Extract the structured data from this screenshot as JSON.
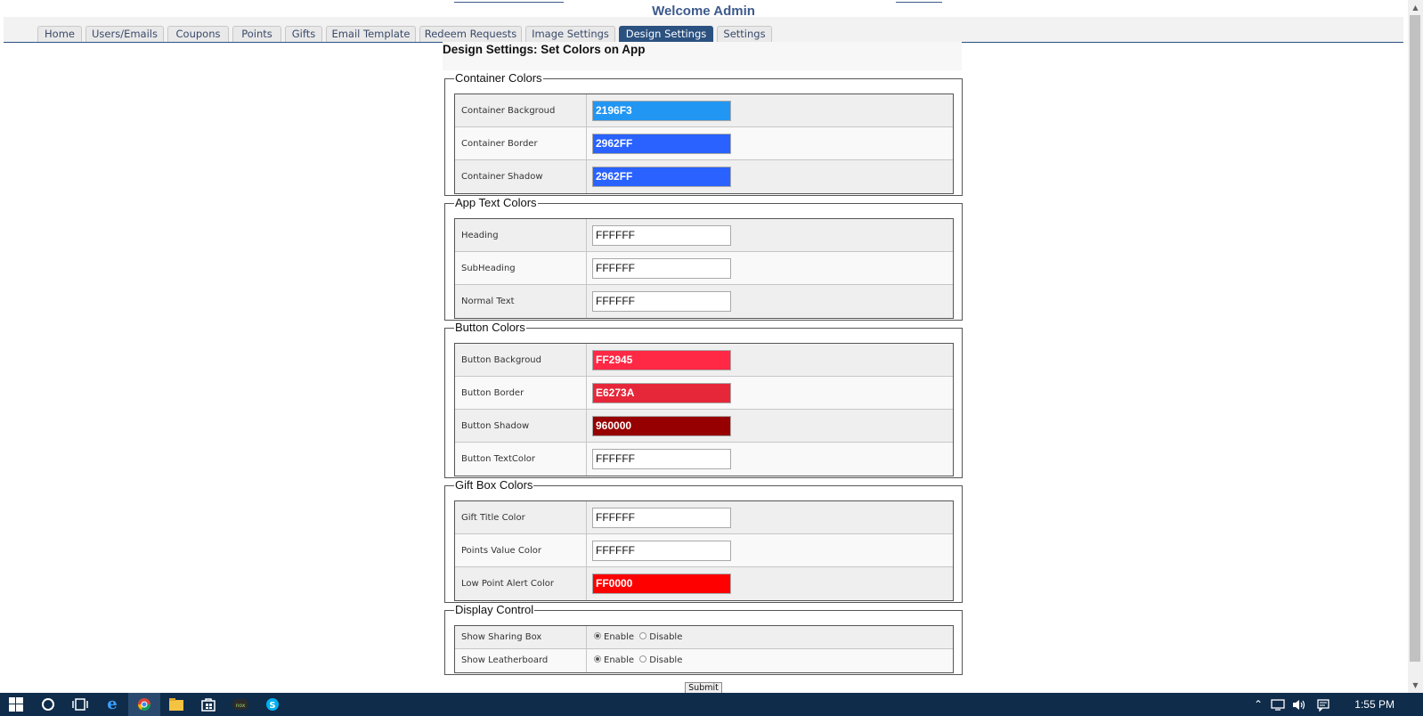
{
  "header": {
    "welcome": "Welcome Admin"
  },
  "nav": {
    "tabs": [
      {
        "label": "Home"
      },
      {
        "label": "Users/Emails"
      },
      {
        "label": "Coupons"
      },
      {
        "label": "Points"
      },
      {
        "label": "Gifts"
      },
      {
        "label": "Email Template"
      },
      {
        "label": "Redeem Requests"
      },
      {
        "label": "Image Settings"
      },
      {
        "label": "Design Settings",
        "active": true
      },
      {
        "label": "Settings"
      }
    ]
  },
  "page": {
    "title": "Design Settings: Set Colors on App"
  },
  "sections": {
    "container": {
      "legend": "Container Colors",
      "rows": [
        {
          "label": "Container Backgroud",
          "value": "2196F3",
          "color": "#2196F3"
        },
        {
          "label": "Container Border",
          "value": "2962FF",
          "color": "#2962FF"
        },
        {
          "label": "Container Shadow",
          "value": "2962FF",
          "color": "#2962FF"
        }
      ]
    },
    "app_text": {
      "legend": "App Text Colors",
      "rows": [
        {
          "label": "Heading",
          "value": "FFFFFF",
          "color": "#FFFFFF"
        },
        {
          "label": "SubHeading",
          "value": "FFFFFF",
          "color": "#FFFFFF"
        },
        {
          "label": "Normal Text",
          "value": "FFFFFF",
          "color": "#FFFFFF"
        }
      ]
    },
    "button": {
      "legend": "Button Colors",
      "rows": [
        {
          "label": "Button Backgroud",
          "value": "FF2945",
          "color": "#FF2945"
        },
        {
          "label": "Button Border",
          "value": "E6273A",
          "color": "#E6273A"
        },
        {
          "label": "Button Shadow",
          "value": "960000",
          "color": "#960000"
        },
        {
          "label": "Button TextColor",
          "value": "FFFFFF",
          "color": "#FFFFFF"
        }
      ]
    },
    "gift_box": {
      "legend": "Gift Box Colors",
      "rows": [
        {
          "label": "Gift Title Color",
          "value": "FFFFFF",
          "color": "#FFFFFF"
        },
        {
          "label": "Points Value Color",
          "value": "FFFFFF",
          "color": "#FFFFFF"
        },
        {
          "label": "Low Point Alert Color",
          "value": "FF0000",
          "color": "#FF0000"
        }
      ]
    },
    "display": {
      "legend": "Display Control",
      "rows": [
        {
          "label": "Show Sharing Box",
          "enable": "Enable",
          "disable": "Disable",
          "selected": "Enable"
        },
        {
          "label": "Show Leatherboard",
          "enable": "Enable",
          "disable": "Disable",
          "selected": "Enable"
        }
      ]
    }
  },
  "form": {
    "submit_label": "Submit"
  },
  "taskbar": {
    "clock": "1:55 PM",
    "icons": [
      "windows-start-icon",
      "cortana-search-icon",
      "task-view-icon",
      "edge-browser-icon",
      "chrome-browser-icon",
      "file-explorer-icon",
      "store-icon",
      "nox-icon",
      "skype-icon"
    ]
  },
  "colors": {
    "nav_active": "#2b5180",
    "welcome": "#3d5a8c",
    "taskbar": "#0f2c4a"
  }
}
